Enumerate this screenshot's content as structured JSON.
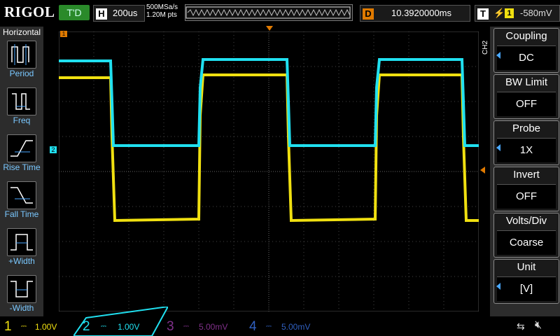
{
  "topbar": {
    "brand": "RIGOL",
    "trigger_status": "T'D",
    "horizontal": {
      "tag": "H",
      "value": "200us"
    },
    "sample_rate": "500MSa/s",
    "memory_depth": "1.20M pts",
    "delay": {
      "tag": "D",
      "value": "10.3920000ms"
    },
    "trigger": {
      "tag": "T",
      "edge": "⚡",
      "source": "1",
      "level": "-580mV"
    }
  },
  "left_panel": {
    "title": "Horizontal",
    "items": [
      {
        "label": "Period",
        "icon": "period-icon"
      },
      {
        "label": "Freq",
        "icon": "freq-icon"
      },
      {
        "label": "Rise Time",
        "icon": "rise-time-icon"
      },
      {
        "label": "Fall Time",
        "icon": "fall-time-icon"
      },
      {
        "label": "+Width",
        "icon": "pos-width-icon"
      },
      {
        "label": "-Width",
        "icon": "neg-width-icon"
      }
    ]
  },
  "right_panel": {
    "channel": "CH2",
    "items": [
      {
        "title": "Coupling",
        "value": "DC",
        "has_arrow": true
      },
      {
        "title": "BW Limit",
        "value": "OFF",
        "has_arrow": false
      },
      {
        "title": "Probe",
        "value": "1X",
        "has_arrow": true
      },
      {
        "title": "Invert",
        "value": "OFF",
        "has_arrow": false
      },
      {
        "title": "Volts/Div",
        "value": "Coarse",
        "has_arrow": false
      },
      {
        "title": "Unit",
        "value": "[V]",
        "has_arrow": true
      }
    ]
  },
  "channels": [
    {
      "num": "1",
      "scale": "1.00V",
      "color": "#f0e010",
      "active": true
    },
    {
      "num": "2",
      "scale": "1.00V",
      "color": "#20e0f0",
      "active": true
    },
    {
      "num": "3",
      "scale": "5.00mV",
      "color": "#c040c0",
      "active": false
    },
    {
      "num": "4",
      "scale": "5.00mV",
      "color": "#3070ff",
      "active": false
    }
  ],
  "markers": {
    "ch1": "1",
    "ch2": "2",
    "trigger_pos": "T"
  },
  "colors": {
    "ch1": "#f0e010",
    "ch2": "#20e0f0",
    "accent": "#e07a00",
    "panel": "#2c2c2c"
  },
  "status_icons": [
    "usb-icon",
    "mute-icon"
  ]
}
